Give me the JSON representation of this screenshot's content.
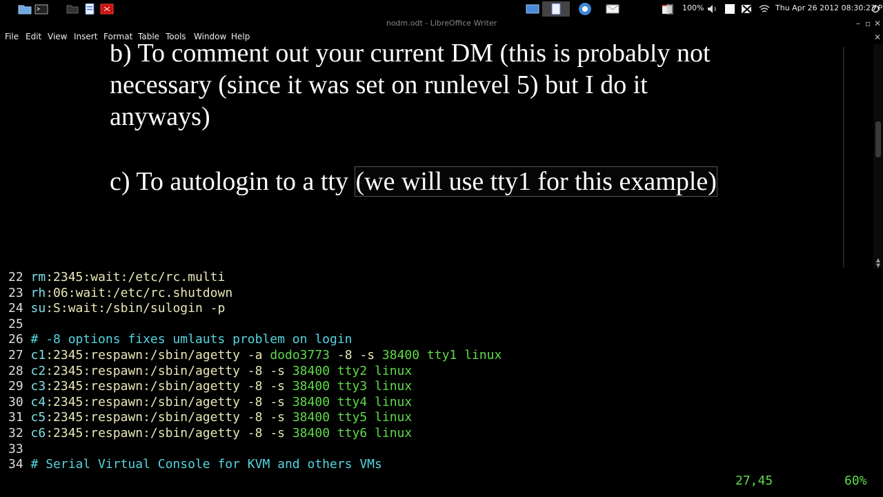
{
  "top_panel": {
    "launchers": [
      "folder-icon",
      "terminal-icon",
      "files-icon",
      "writer-icon",
      "pdf-icon"
    ],
    "tasks": [
      "window-icon",
      "document-icon",
      "browser-icon",
      "mail-icon"
    ],
    "battery": "100%",
    "clock": "Thu Apr 26 2012  08:30:23 PM"
  },
  "window": {
    "title": "nodm.odt - LibreOffice Writer"
  },
  "menu": [
    "File",
    "Edit",
    "View",
    "Insert",
    "Format",
    "Table",
    "Tools",
    "Window",
    "Help"
  ],
  "document": {
    "lines": [
      "b) To comment out your current DM (this is probably not",
      "necessary (since it was set on runlevel 5) but I do it",
      "anyways)"
    ],
    "item_c_prefix": "c) To autologin to a tty ",
    "item_c_selected": "(we will use tty1 for this example)"
  },
  "terminal": {
    "lines": [
      {
        "n": "22",
        "segs": [
          {
            "t": "rm",
            "c": "kw"
          },
          {
            "t": ":2345:",
            "c": "yel"
          },
          {
            "t": "wait",
            "c": "yel"
          },
          {
            "t": ":/etc/rc.multi",
            "c": "yel"
          }
        ]
      },
      {
        "n": "23",
        "segs": [
          {
            "t": "rh",
            "c": "kw"
          },
          {
            "t": ":06:",
            "c": "yel"
          },
          {
            "t": "wait",
            "c": "yel"
          },
          {
            "t": ":/etc/rc.shutdown",
            "c": "yel"
          }
        ]
      },
      {
        "n": "24",
        "segs": [
          {
            "t": "su",
            "c": "kw"
          },
          {
            "t": ":S:",
            "c": "yel"
          },
          {
            "t": "wait",
            "c": "yel"
          },
          {
            "t": ":/sbin/sulogin -p",
            "c": "yel"
          }
        ]
      },
      {
        "n": "25",
        "segs": []
      },
      {
        "n": "26",
        "segs": [
          {
            "t": "# -8 options fixes umlauts problem on login",
            "c": "cmt"
          }
        ]
      },
      {
        "n": "27",
        "segs": [
          {
            "t": "c1",
            "c": "kw"
          },
          {
            "t": ":2345:",
            "c": "yel"
          },
          {
            "t": "respawn",
            "c": "yel"
          },
          {
            "t": ":/sbin/agetty -a ",
            "c": "yel"
          },
          {
            "t": "dodo3773",
            "c": "grn"
          },
          {
            "t": " -8 -s ",
            "c": "yel"
          },
          {
            "t": "38400 tty1 linux",
            "c": "grn"
          }
        ]
      },
      {
        "n": "28",
        "segs": [
          {
            "t": "c2",
            "c": "kw"
          },
          {
            "t": ":2345:",
            "c": "yel"
          },
          {
            "t": "respawn",
            "c": "yel"
          },
          {
            "t": ":/sbin/agetty -8 -s ",
            "c": "yel"
          },
          {
            "t": "38400 tty2 linux",
            "c": "grn"
          }
        ]
      },
      {
        "n": "29",
        "segs": [
          {
            "t": "c3",
            "c": "kw"
          },
          {
            "t": ":2345:",
            "c": "yel"
          },
          {
            "t": "respawn",
            "c": "yel"
          },
          {
            "t": ":/sbin/agetty -8 -s ",
            "c": "yel"
          },
          {
            "t": "38400 tty3 linux",
            "c": "grn"
          }
        ]
      },
      {
        "n": "30",
        "segs": [
          {
            "t": "c4",
            "c": "kw"
          },
          {
            "t": ":2345:",
            "c": "yel"
          },
          {
            "t": "respawn",
            "c": "yel"
          },
          {
            "t": ":/sbin/agetty -8 -s ",
            "c": "yel"
          },
          {
            "t": "38400 tty4 linux",
            "c": "grn"
          }
        ]
      },
      {
        "n": "31",
        "segs": [
          {
            "t": "c5",
            "c": "kw"
          },
          {
            "t": ":2345:",
            "c": "yel"
          },
          {
            "t": "respawn",
            "c": "yel"
          },
          {
            "t": ":/sbin/agetty -8 -s ",
            "c": "yel"
          },
          {
            "t": "38400 tty5 linux",
            "c": "grn"
          }
        ]
      },
      {
        "n": "32",
        "segs": [
          {
            "t": "c6",
            "c": "kw"
          },
          {
            "t": ":2345:",
            "c": "yel"
          },
          {
            "t": "respawn",
            "c": "yel"
          },
          {
            "t": ":/sbin/agetty -8 -s ",
            "c": "yel"
          },
          {
            "t": "38400 tty6 linux",
            "c": "grn"
          }
        ]
      },
      {
        "n": "33",
        "segs": []
      },
      {
        "n": "34",
        "segs": [
          {
            "t": "# Serial Virtual Console for KVM and others VMs",
            "c": "cmt"
          }
        ]
      }
    ],
    "status_position": "27,45",
    "status_percent": "60%"
  },
  "colors": {
    "keyword": "#7ee0e8",
    "string": "#5fdb4a",
    "comment": "#55d5e0",
    "background": "#000000"
  }
}
